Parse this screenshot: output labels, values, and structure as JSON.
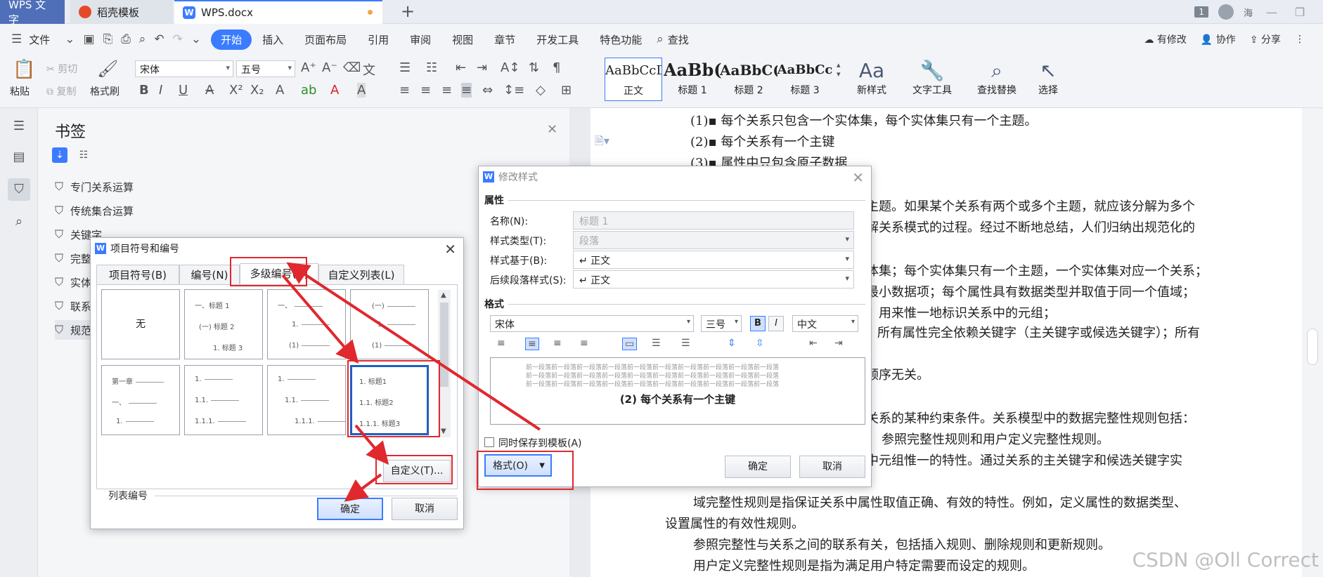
{
  "tabs": {
    "app": "WPS 文字",
    "template": "稻壳模板",
    "document": "WPS.docx",
    "page_count_badge": "1",
    "user_name": "海"
  },
  "menu": {
    "file": "文件",
    "items": [
      "开始",
      "插入",
      "页面布局",
      "引用",
      "审阅",
      "视图",
      "章节",
      "开发工具",
      "特色功能",
      "查找"
    ],
    "right": [
      "有修改",
      "协作",
      "分享"
    ]
  },
  "ribbon": {
    "paste": "粘贴",
    "cut": "剪切",
    "copy": "复制",
    "format_painter": "格式刷",
    "font_name": "宋体",
    "font_size": "五号",
    "styles": [
      {
        "preview": "AaBbCcDd",
        "label": "正文"
      },
      {
        "preview": "AaBb(",
        "label": "标题 1"
      },
      {
        "preview": "AaBbC(",
        "label": "标题 2"
      },
      {
        "preview": "AaBbCc",
        "label": "标题 3"
      }
    ],
    "new_style": "新样式",
    "text_tools": "文字工具",
    "find_replace": "查找替换",
    "select": "选择"
  },
  "bookmark_panel": {
    "title": "书签",
    "items": [
      "专门关系运算",
      "传统集合运算",
      "关键字",
      "完整",
      "实体",
      "联系",
      "规范"
    ]
  },
  "document": {
    "lines": [
      "(1)▪ 每个关系只包含一个实体集，每个实体集只有一个主题。",
      "(2)▪ 每个关系有一个主键",
      "(3)▪ 属性中只包含原子数据",
      "主题。如果某个关系有两个或多个主题，就应该分解为多个",
      "解关系模式的过程。经过不断地总结，人们归纳出规范化的",
      "体集；每个实体集只有一个主题，一个实体集对应一个关系；",
      "最小数据项；每个属性具有数据类型并取值于同一个值域；",
      "，用来惟一地标识关系中的元组；",
      "所有属性完全依赖关键字（主关键字或候选关键字）；所有",
      "顺序无关。",
      "关系的某种约束条件。关系模型中的数据完整性规则包括：",
      "参照完整性规则和用户定义完整性规则。",
      "中元组惟一的特性。通过关系的主关键字和候选关键字实",
      "域完整性规则是指保证关系中属性取值正确、有效的特性。例如，定义属性的数据类型、",
      "设置属性的有效性规则。",
      "参照完整性与关系之间的联系有关，包括插入规则、删除规则和更新规则。",
      "用户定义完整性规则是指为满足用户特定需要而设定的规则。"
    ]
  },
  "bullets_dialog": {
    "title": "项目符号和编号",
    "tabs": [
      "项目符号(B)",
      "编号(N)",
      "多级编号(U)",
      "自定义列表(L)"
    ],
    "none_label": "无",
    "cell2": [
      "一、标题 1",
      "(一) 标题 2",
      "1. 标题 3"
    ],
    "cell3": [
      "一、",
      "1.",
      "(1)"
    ],
    "cell4": [
      "(一)",
      "1.",
      "(1)"
    ],
    "cell5": [
      "第一章",
      "一、",
      "1."
    ],
    "cell6": [
      "1.",
      "1.1.",
      "1.1.1."
    ],
    "cell7": [
      "1.",
      "1.1.",
      "1.1.1."
    ],
    "cell8": [
      "1. 标题1",
      "1.1. 标题2",
      "1.1.1. 标题3"
    ],
    "list_numbering_label": "列表编号",
    "customize": "自定义(T)...",
    "ok": "确定",
    "cancel": "取消"
  },
  "modify_dialog": {
    "title": "修改样式",
    "properties_section": "属性",
    "name_label": "名称(N):",
    "name_value": "标题 1",
    "type_label": "样式类型(T):",
    "type_value": "段落",
    "based_on_label": "样式基于(B):",
    "based_on_value": "↵ 正文",
    "next_label": "后续段落样式(S):",
    "next_value": "↵ 正文",
    "format_section": "格式",
    "font": "宋体",
    "size": "三号",
    "bold": "B",
    "italic": "I",
    "script": "中文",
    "preview_filler": "前一段落前一段落前一段落前一段落前一段落前一段落前一段落前一段落前一段落前一段落",
    "preview_text": "(2)  每个关系有一个主键",
    "save_template": "同时保存到模板(A)",
    "format_button": "格式(O)",
    "ok": "确定",
    "cancel": "取消"
  },
  "watermark": "CSDN @Oll Correct"
}
